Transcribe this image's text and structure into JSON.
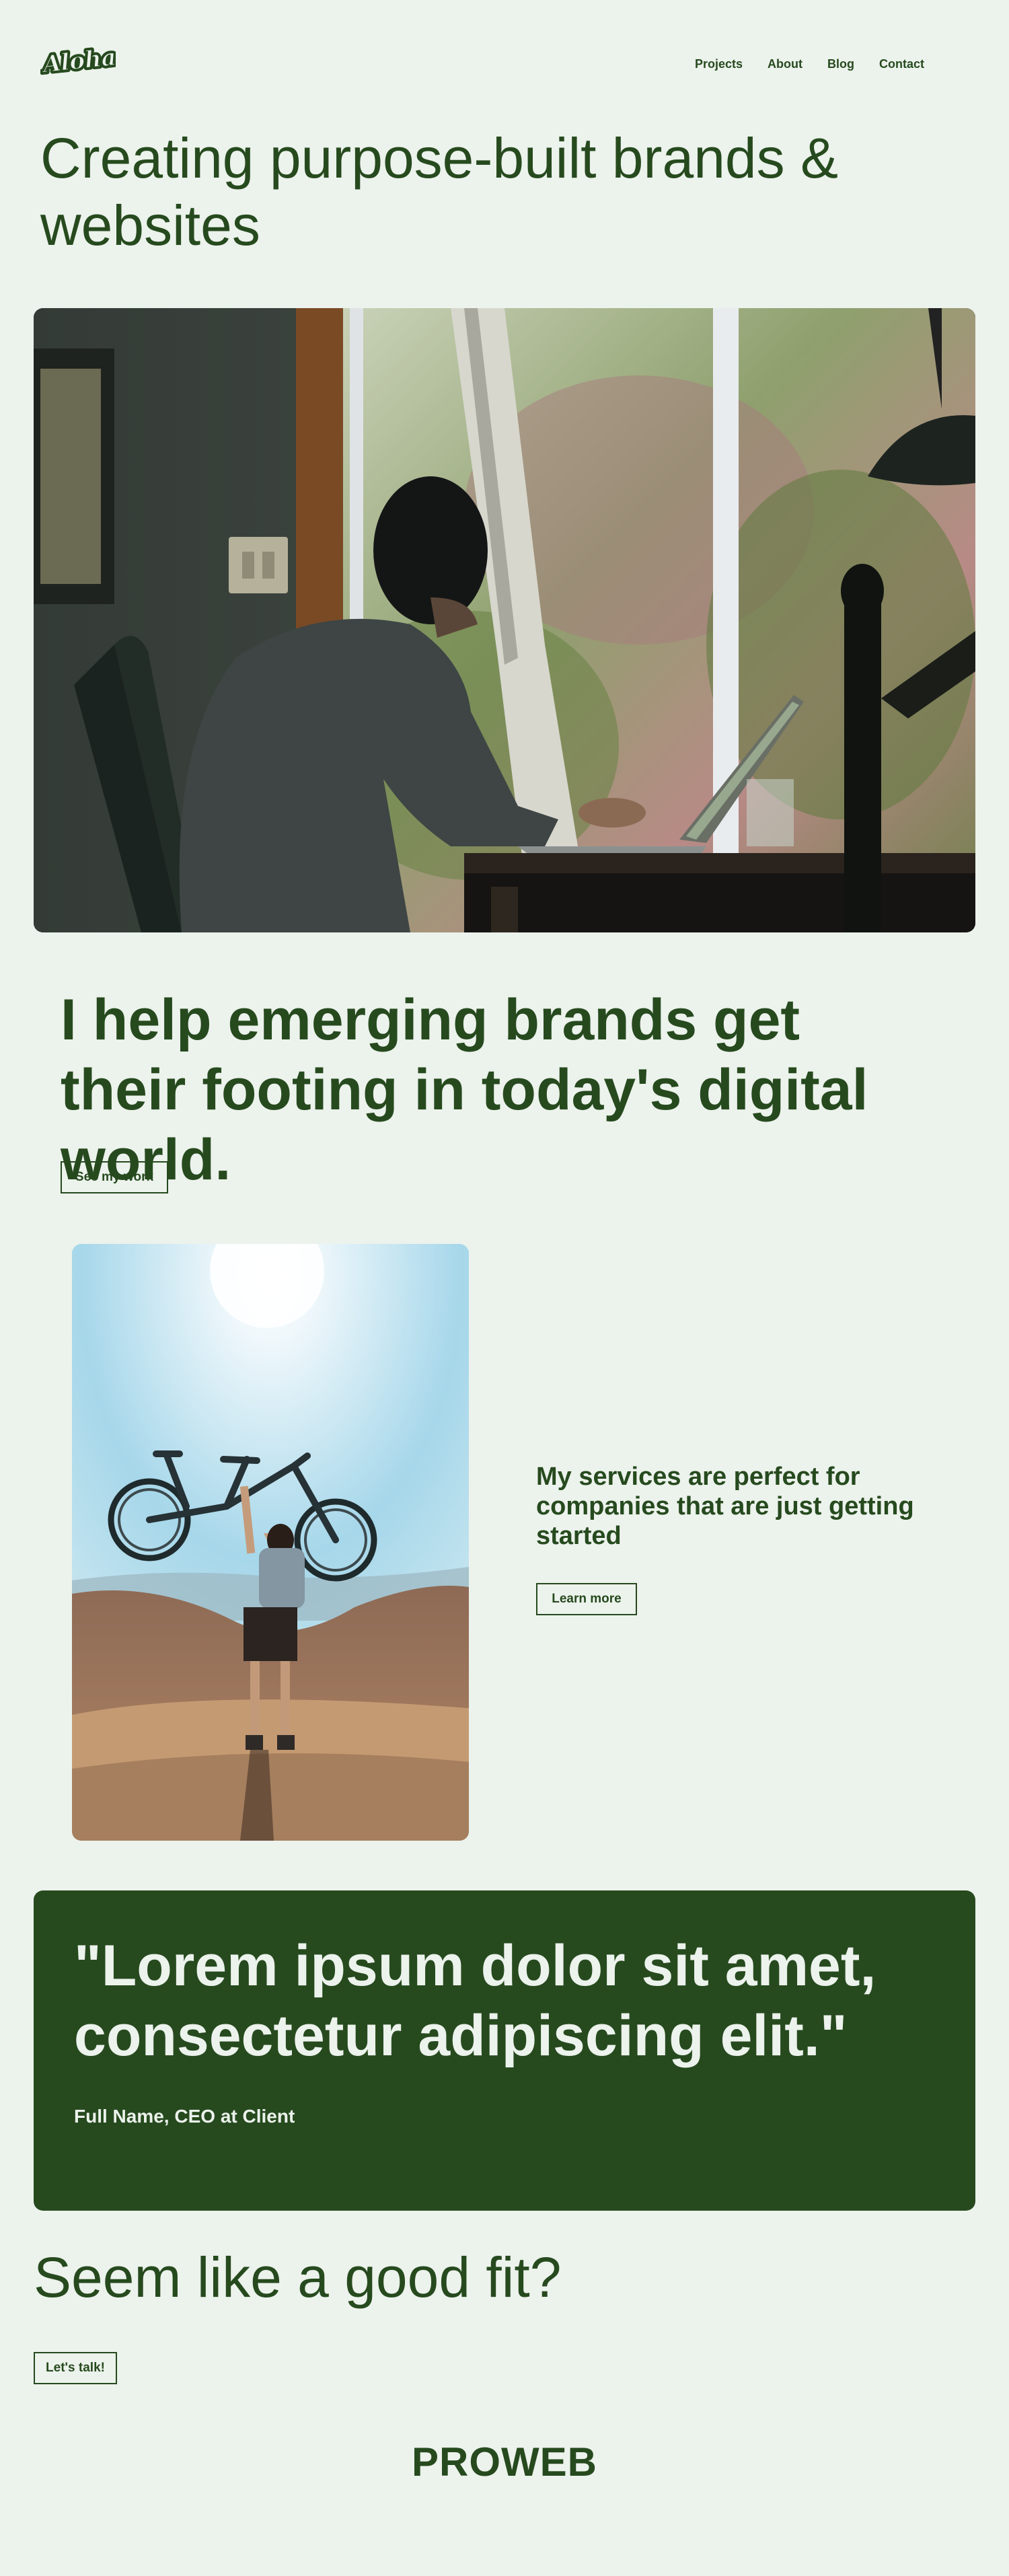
{
  "header": {
    "logo_text": "Aloha",
    "nav": [
      "Projects",
      "About",
      "Blog",
      "Contact"
    ]
  },
  "hero": {
    "title": "Creating purpose-built brands & websites"
  },
  "intro": {
    "heading": "I help emerging brands get their footing in today's digital world.",
    "cta": "See my work"
  },
  "services": {
    "text": "My services are perfect for companies that are just getting started",
    "cta": "Learn more"
  },
  "testimonial": {
    "quote": "\"Lorem ipsum dolor sit amet, consectetur adipiscing elit.\"",
    "author": "Full Name, CEO at Client"
  },
  "contact": {
    "title": "Seem like a good fit?",
    "cta": "Let's talk!"
  },
  "footer": {
    "brand": "PROWEB"
  },
  "colors": {
    "background": "#ecf2ec",
    "primary": "#264a1e",
    "on_primary": "#ecf2ec"
  }
}
